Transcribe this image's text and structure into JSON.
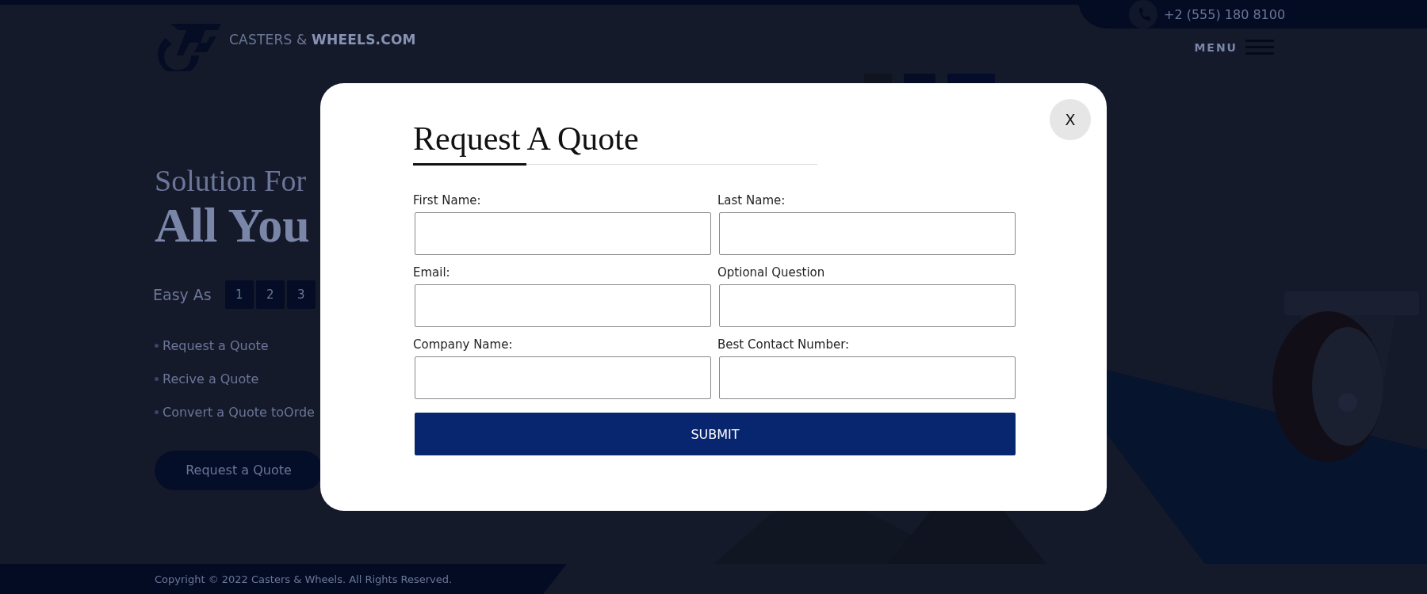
{
  "header": {
    "logo_text": "CASTERS & **WHEELS.COM**",
    "phone": "+2 (555) 180 8100",
    "menu_label": "MENU"
  },
  "hero": {
    "kicker": "Solution For",
    "headline": "All You",
    "steps_label": "Easy As",
    "steps": [
      "1",
      "2",
      "3"
    ],
    "bullets": [
      "Request a Quote",
      "Recive a Quote",
      "Convert a Quote toOrde"
    ],
    "cta": "Request a Quote"
  },
  "footer": {
    "copyright": "Copyright © 2022 Casters & Wheels. All Rights Reserved."
  },
  "modal": {
    "title": "Request A Quote",
    "close": "X",
    "fields": [
      {
        "label": "First Name:"
      },
      {
        "label": "Last Name:"
      },
      {
        "label": "Email:"
      },
      {
        "label": "Optional Question"
      },
      {
        "label": "Company Name:"
      },
      {
        "label": "Best Contact Number:"
      }
    ],
    "submit": "SUBMIT"
  }
}
